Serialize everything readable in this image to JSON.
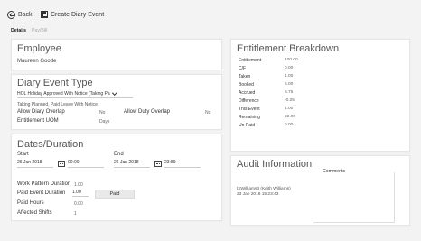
{
  "toolbar": {
    "back_label": "Back",
    "create_label": "Create Diary Event"
  },
  "tabs": [
    {
      "label": "Details",
      "active": true
    },
    {
      "label": "Pay/Bill",
      "active": false
    }
  ],
  "employee": {
    "title": "Employee",
    "name": "Maureen Goode"
  },
  "diary_event_type": {
    "title": "Diary Event Type",
    "selected": "HOL Holiday Approved With Notice (Taking Pa",
    "description": "Taking Planned, Paid Leave With Notice",
    "allow_diary_overlap_label": "Allow Diary Overlap",
    "allow_diary_overlap_value": "No",
    "allow_duty_overlap_label": "Allow Duty Overlap",
    "allow_duty_overlap_value": "No",
    "entitlement_uom_label": "Entitlement UOM",
    "entitlement_uom_value": "Days"
  },
  "dates_duration": {
    "title": "Dates/Duration",
    "start_label": "Start",
    "start_date": "26 Jan 2018",
    "start_time": "00:00",
    "end_label": "End",
    "end_date": "26 Jan 2018",
    "end_time": "23:59",
    "work_pattern_duration_label": "Work Pattern Duration",
    "work_pattern_duration_value": "1.00",
    "paid_event_duration_label": "Paid Event Duration",
    "paid_event_duration_value": "1.00",
    "paid_button_label": "Paid",
    "paid_hours_label": "Paid Hours",
    "paid_hours_value": "0.00",
    "affected_shifts_label": "Affected Shifts",
    "affected_shifts_value": "1"
  },
  "entitlement": {
    "title": "Entitlement Breakdown",
    "rows": [
      {
        "label": "Entitlement",
        "value": "100.00"
      },
      {
        "label": "C/F",
        "value": "0.00"
      },
      {
        "label": "Taken",
        "value": "1.00"
      },
      {
        "label": "Booked",
        "value": "6.00"
      },
      {
        "label": "Accrued",
        "value": "6.75"
      },
      {
        "label": "Difference",
        "value": "-0.25"
      },
      {
        "label": "This Event",
        "value": "1.00"
      },
      {
        "label": "Remaining",
        "value": "92.00"
      },
      {
        "label": "Un-Paid",
        "value": "0.00"
      }
    ]
  },
  "audit": {
    "title": "Audit Information",
    "comments_label": "Comments",
    "user": "tSWilliams3 (Keith Williams)",
    "timestamp": "23 Jan 2018 15:23:43"
  }
}
